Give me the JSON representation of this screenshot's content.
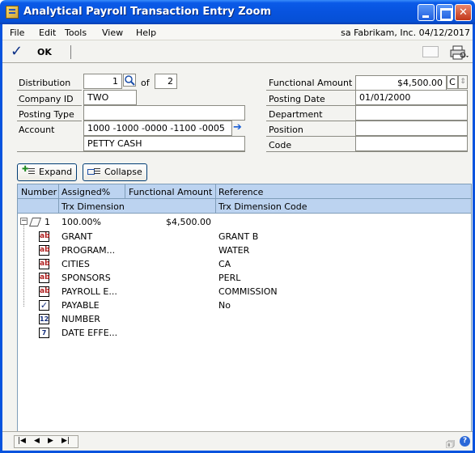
{
  "window": {
    "title": "Analytical Payroll Transaction Entry Zoom"
  },
  "menu": {
    "items": [
      "File",
      "Edit",
      "Tools",
      "View",
      "Help"
    ],
    "user_info": "sa  Fabrikam, Inc. 04/12/2017"
  },
  "toolbar": {
    "ok_label": "OK"
  },
  "form": {
    "distribution_label": "Distribution",
    "distribution_value": "1",
    "of_label": "of",
    "distribution_total": "2",
    "company_id_label": "Company ID",
    "company_id_value": "TWO",
    "posting_type_label": "Posting Type",
    "posting_type_value": "",
    "account_label": "Account",
    "account_value": "1000 -1000 -0000 -1100 -0005",
    "account_description": "PETTY CASH",
    "functional_amount_label": "Functional Amount",
    "functional_amount_value": "$4,500.00",
    "currency_button": "C",
    "posting_date_label": "Posting Date",
    "posting_date_value": "01/01/2000",
    "department_label": "Department",
    "department_value": "",
    "position_label": "Position",
    "position_value": "",
    "code_label": "Code",
    "code_value": ""
  },
  "buttons": {
    "expand": "Expand",
    "collapse": "Collapse"
  },
  "grid": {
    "header1": [
      "Number",
      "Assigned%",
      "Functional Amount",
      "Reference"
    ],
    "header2": [
      "Trx Dimension",
      "Trx Dimension Code"
    ],
    "main_row": {
      "number": "1",
      "assigned": "100.00%",
      "amount": "$4,500.00",
      "reference": ""
    },
    "sub_rows": [
      {
        "icon": "ab",
        "dimension": "GRANT",
        "code": "GRANT B"
      },
      {
        "icon": "ab",
        "dimension": "PROGRAM...",
        "code": "WATER"
      },
      {
        "icon": "ab",
        "dimension": "CITIES",
        "code": "CA"
      },
      {
        "icon": "ab",
        "dimension": "SPONSORS",
        "code": "PERL"
      },
      {
        "icon": "ab",
        "dimension": "PAYROLL E...",
        "code": "COMMISSION"
      },
      {
        "icon": "check",
        "dimension": "PAYABLE",
        "code": "No"
      },
      {
        "icon": "12",
        "dimension": "NUMBER",
        "code": ""
      },
      {
        "icon": "date",
        "dimension": "DATE EFFE...",
        "code": ""
      }
    ]
  },
  "colors": {
    "titlebar": "#0753de",
    "grid_header": "#bcd3f0",
    "window_bg": "#f3f3f0"
  }
}
